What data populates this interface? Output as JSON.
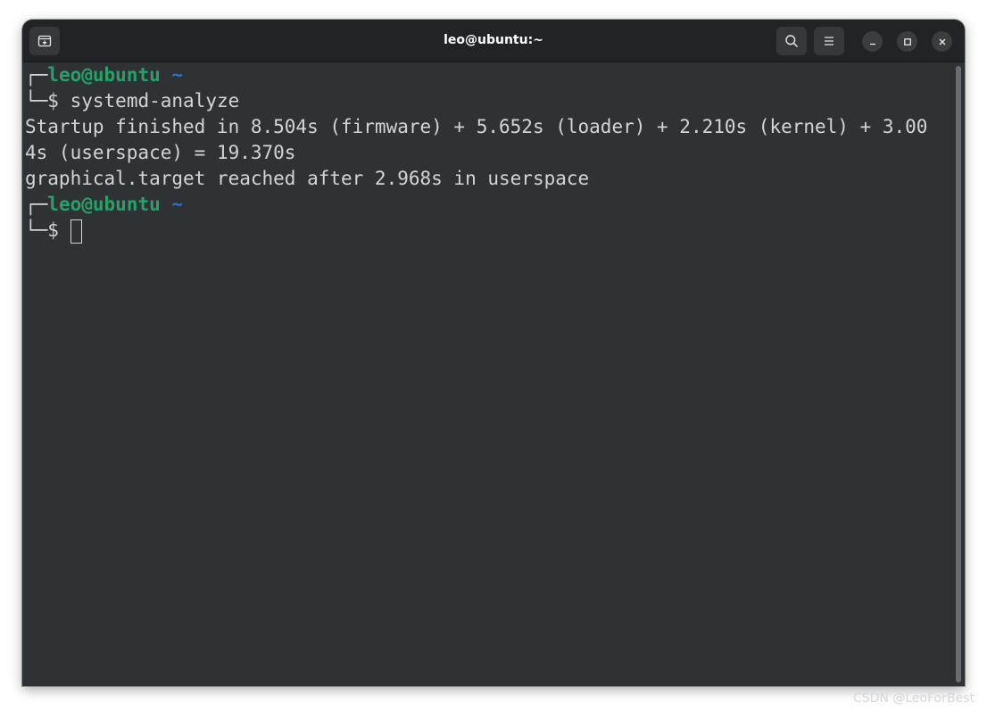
{
  "window": {
    "title": "leo@ubuntu:~"
  },
  "titlebar": {
    "new_tab_icon": "new-tab-icon",
    "search_icon": "search-icon",
    "menu_icon": "hamburger-menu-icon",
    "minimize_icon": "minimize-icon",
    "maximize_icon": "maximize-icon",
    "close_icon": "close-icon"
  },
  "terminal": {
    "prompt_top": "┌─",
    "prompt_bottom": "└─",
    "prompt_user": "leo@ubuntu",
    "prompt_dir": "~",
    "prompt_symbol": "$",
    "command": "systemd-analyze",
    "output": [
      "Startup finished in 8.504s (firmware) + 5.652s (loader) + 2.210s (kernel) + 3.00",
      "4s (userspace) = 19.370s",
      "graphical.target reached after 2.968s in userspace"
    ]
  },
  "colors": {
    "background": "#2e3235",
    "titlebar": "#222326",
    "text": "#d4d4d4",
    "prompt_user": "#26a269",
    "prompt_dir": "#2a6fc9"
  },
  "watermark": "CSDN @LeoForBest"
}
